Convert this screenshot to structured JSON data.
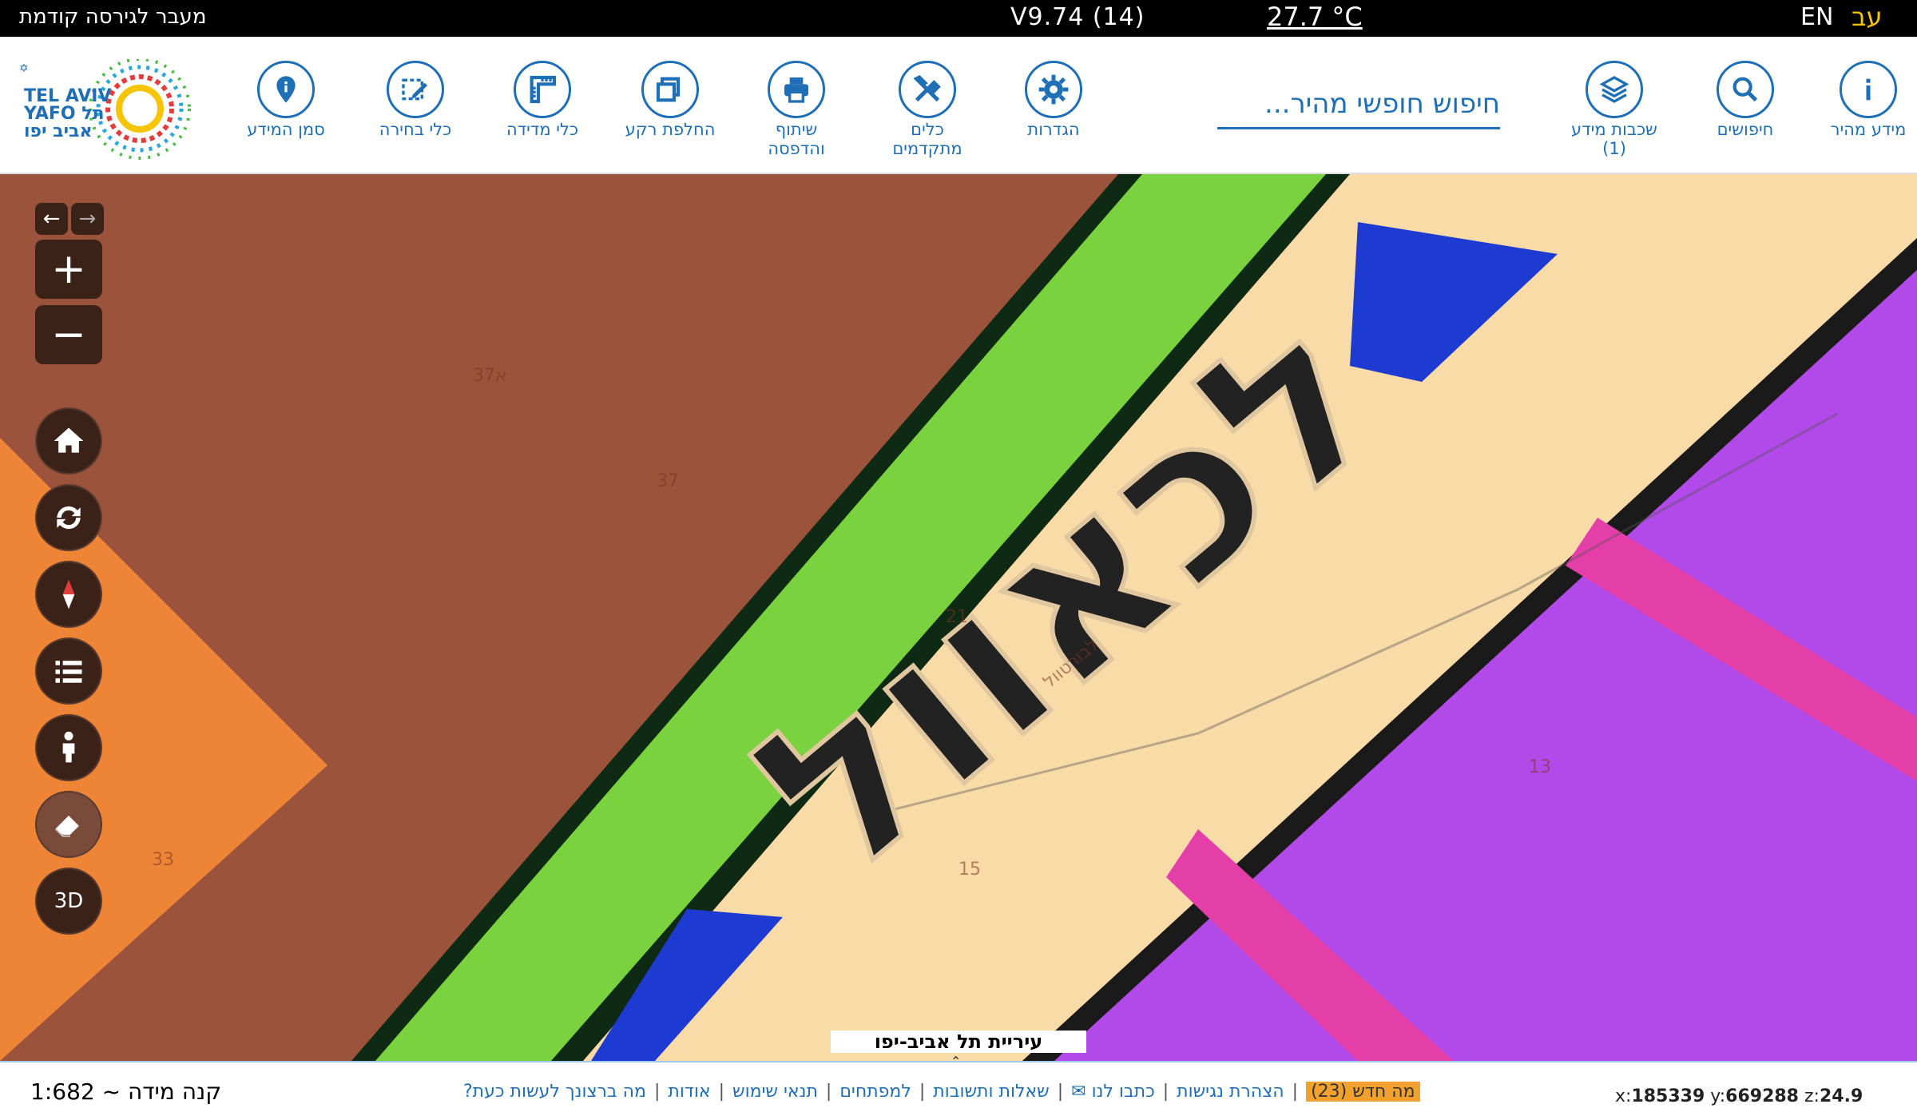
{
  "topbar": {
    "prev_version": "מעבר לגירסה קודמת",
    "version": "V9.74 (14)",
    "temperature": "27.7 °C",
    "lang_en": "EN",
    "lang_he": "עב"
  },
  "toolbar": {
    "logo_text": "TEL AVIV YAFO תל אביב יפו",
    "buttons": {
      "quick_info": "מידע מהיר",
      "searches": "חיפושים",
      "layers": "שכבות מידע",
      "layers_count": "(1)",
      "settings": "הגדרות",
      "advanced_tools_1": "כלים",
      "advanced_tools_2": "מתקדמים",
      "share_print_1": "שיתוף",
      "share_print_2": "והדפסה",
      "background": "החלפת רקע",
      "measure": "כלי מדידה",
      "select": "כלי בחירה",
      "info_marker": "סמן המידע"
    },
    "search_placeholder": "חיפוש חופשי מהיר..."
  },
  "map": {
    "parcel_labels": [
      "37א",
      "37",
      "21",
      "33",
      "15",
      "13"
    ],
    "street_label": "לבורטוול",
    "zone_text": "לכאוול",
    "controls": {
      "back_arrow": "←",
      "fwd_arrow": "→",
      "zoom_in": "+",
      "zoom_out": "−",
      "three_d": "3D"
    },
    "city_label": "עיריית תל אביב-יפו"
  },
  "footer": {
    "scale": "קנה מידה ~ 1:682",
    "links": [
      "מה ברצונך לעשות כעת?",
      "אודות",
      "תנאי שימוש",
      "למפתחים",
      "שאלות ותשובות",
      "כתבו לנו ✉",
      "הצהרת נגישות"
    ],
    "whats_new": "מה חדש (23)",
    "coord_x_label": "x:",
    "coord_x": "185339",
    "coord_y_label": "y:",
    "coord_y": "669288",
    "coord_z_label": "z:",
    "coord_z": "24.9"
  },
  "colors": {
    "accent": "#1e6fb5",
    "brown": "#9c533c",
    "orange": "#ee8436",
    "green": "#7ad23f",
    "cream": "#f8dba6",
    "purple": "#b14ae8",
    "pink": "#e43ea9",
    "blue": "#1d3bd0"
  }
}
